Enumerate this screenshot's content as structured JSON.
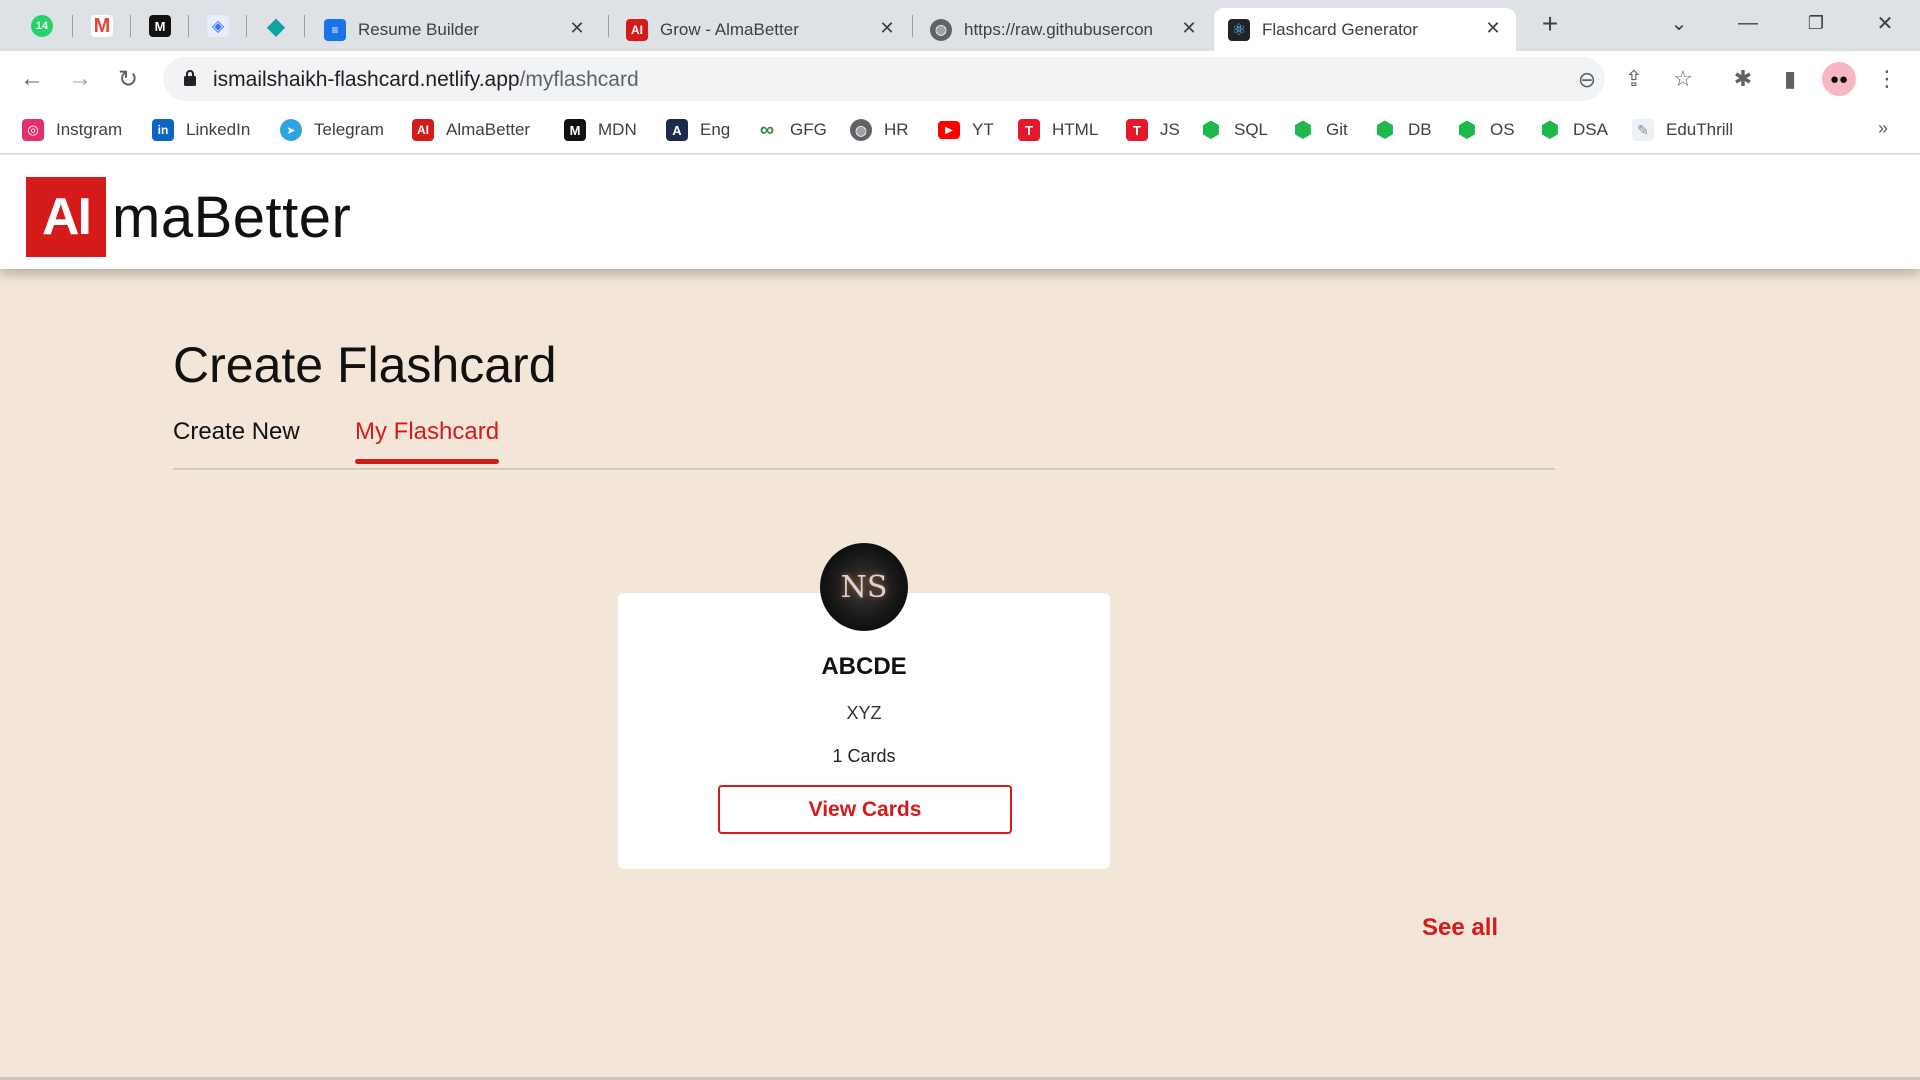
{
  "browser": {
    "pinned_tabs": [
      {
        "icon": "whatsapp-icon",
        "badge": "14",
        "color": "#25d366"
      },
      {
        "icon": "gmail-icon",
        "label": "M",
        "color": "#ea4335"
      },
      {
        "icon": "mdn-icon",
        "label": "M",
        "color": "#111111"
      },
      {
        "icon": "devfolio-icon",
        "label": "◈",
        "color": "#3770ff"
      },
      {
        "icon": "diamond-icon",
        "label": "◆",
        "color": "#14a1a1"
      }
    ],
    "tabs": [
      {
        "title": "Resume Builder",
        "icon": "doc-icon",
        "active": false
      },
      {
        "title": "Grow - AlmaBetter",
        "icon": "almabetter-icon",
        "active": false
      },
      {
        "title": "https://raw.githubusercon",
        "icon": "globe-icon",
        "active": false
      },
      {
        "title": "Flashcard Generator",
        "icon": "react-icon",
        "active": true
      }
    ],
    "url_domain": "ismailshaikh-flashcard.netlify.app",
    "url_path": "/myflashcard",
    "bookmarks": [
      {
        "label": "Instgram",
        "icon": "instagram-icon",
        "color": "#e1306c",
        "glyph": "◎"
      },
      {
        "label": "LinkedIn",
        "icon": "linkedin-icon",
        "color": "#0a66c2",
        "glyph": "in"
      },
      {
        "label": "Telegram",
        "icon": "telegram-icon",
        "color": "#2ca5e0",
        "glyph": "➤"
      },
      {
        "label": "AlmaBetter",
        "icon": "almabetter-icon",
        "color": "#d51a1a",
        "glyph": "AI"
      },
      {
        "label": "MDN",
        "icon": "mdn-icon",
        "color": "#111111",
        "glyph": "M"
      },
      {
        "label": "Eng",
        "icon": "translate-icon",
        "color": "#1a2b4c",
        "glyph": "A"
      },
      {
        "label": "GFG",
        "icon": "gfg-icon",
        "color": "#2f8d46",
        "glyph": "∞"
      },
      {
        "label": "HR",
        "icon": "globe-icon",
        "color": "#5f6368",
        "glyph": "◍"
      },
      {
        "label": "YT",
        "icon": "youtube-icon",
        "color": "#ff0000",
        "glyph": "▶"
      },
      {
        "label": "HTML",
        "icon": "tutorial-icon",
        "color": "#e4172b",
        "glyph": "T"
      },
      {
        "label": "JS",
        "icon": "tutorial-icon",
        "color": "#e4172b",
        "glyph": "T"
      },
      {
        "label": "SQL",
        "icon": "hexagon-icon",
        "color": "#1fb84c",
        "glyph": "⬢"
      },
      {
        "label": "Git",
        "icon": "hexagon-icon",
        "color": "#1fb84c",
        "glyph": "⬢"
      },
      {
        "label": "DB",
        "icon": "hexagon-icon",
        "color": "#1fb84c",
        "glyph": "⬢"
      },
      {
        "label": "OS",
        "icon": "hexagon-icon",
        "color": "#1fb84c",
        "glyph": "⬢"
      },
      {
        "label": "DSA",
        "icon": "hexagon-icon",
        "color": "#1fb84c",
        "glyph": "⬢"
      },
      {
        "label": "EduThrill",
        "icon": "eduthrill-icon",
        "color": "#7a8a99",
        "glyph": "✎"
      }
    ],
    "more_bookmarks": "»"
  },
  "app": {
    "logo_mark": "AI",
    "logo_text": "maBetter",
    "page_title": "Create Flashcard",
    "tabs": [
      {
        "label": "Create New",
        "active": false
      },
      {
        "label": "My Flashcard",
        "active": true
      }
    ],
    "card": {
      "avatar_text": "NS",
      "title": "ABCDE",
      "description": "XYZ",
      "count": "1 Cards",
      "button": "View Cards"
    },
    "see_all": "See all",
    "accent_color": "#d51a1a",
    "background_color": "#f3e6d9"
  }
}
